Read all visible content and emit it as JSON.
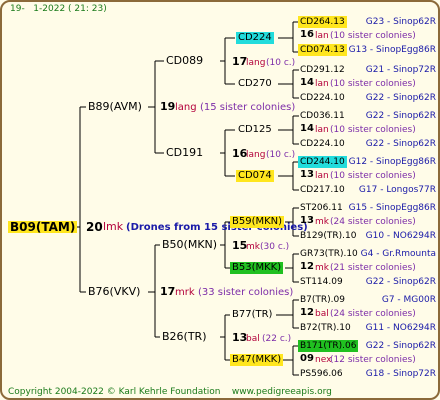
{
  "header": {
    "id_prefix": "19-",
    "datetime": "1-2022 ( 21: 23)"
  },
  "footer": {
    "copyright": "Copyright 2004-2022 © Karl Kehrle Foundation",
    "site": "www.pedigreeapis.org"
  },
  "colors": {
    "yellow": "#ffe61e",
    "cyan": "#22dcdc",
    "lime": "#20c020",
    "tree_line": "#000000",
    "border": "#8b6a3a"
  },
  "root": {
    "name": "B09(TAM)",
    "num": "20",
    "code": "lmk",
    "note": "(Drones from 15 sister colonies)"
  },
  "gen2": [
    {
      "name": "B89(AVM)",
      "num": "19",
      "code": "lang",
      "note": "(15 sister colonies)"
    },
    {
      "name": "B76(VKV)",
      "num": "17",
      "code": "mrk",
      "note": "(33 sister colonies)"
    }
  ],
  "gen3": [
    {
      "name": "CD089",
      "num": "17",
      "code": "lang",
      "note": "(10 c.)"
    },
    {
      "name": "CD191",
      "num": "16",
      "code": "lang",
      "note": "(10 c.)"
    },
    {
      "name": "B50(MKN)",
      "num": "15",
      "code": "mk",
      "note": "(30 c.)"
    },
    {
      "name": "B26(TR)",
      "num": "13",
      "code": "bal",
      "note": "(22 c.)"
    }
  ],
  "gen4": [
    {
      "name": "CD224",
      "hl": "cyan"
    },
    {
      "name": "CD270",
      "hl": ""
    },
    {
      "name": "CD125",
      "hl": ""
    },
    {
      "name": "CD074",
      "hl": "yellow"
    },
    {
      "name": "B59(MKN)",
      "hl": "yellow"
    },
    {
      "name": "B53(MKK)",
      "hl": "lime"
    },
    {
      "name": "B77(TR)",
      "hl": ""
    },
    {
      "name": "B47(MKK)",
      "hl": "yellow"
    }
  ],
  "gen5": [
    {
      "top": "CD264.13",
      "top_hl": "yellow",
      "top_ref": "G23 - Sinop62R",
      "num": "16",
      "code": "lan",
      "note": "(10 sister colonies)",
      "bot": "CD074.13",
      "bot_hl": "yellow",
      "bot_ref": "G13 - SinopEgg86R"
    },
    {
      "top": "CD291.12",
      "top_hl": "",
      "top_ref": "G21 - Sinop72R",
      "num": "14",
      "code": "lan",
      "note": "(10 sister colonies)",
      "bot": "CD224.10",
      "bot_hl": "",
      "bot_ref": "G22 - Sinop62R"
    },
    {
      "top": "CD036.11",
      "top_hl": "",
      "top_ref": "G22 - Sinop62R",
      "num": "14",
      "code": "lan",
      "note": "(10 sister colonies)",
      "bot": "CD224.10",
      "bot_hl": "",
      "bot_ref": "G22 - Sinop62R"
    },
    {
      "top": "CD244.10",
      "top_hl": "cyan",
      "top_ref": "G12 - SinopEgg86R",
      "num": "13",
      "code": "lan",
      "note": "(10 sister colonies)",
      "bot": "CD217.10",
      "bot_hl": "",
      "bot_ref": "G17 - Longos77R"
    },
    {
      "top": "ST206.11",
      "top_hl": "",
      "top_ref": "G15 - SinopEgg86R",
      "num": "13",
      "code": "mk",
      "note": "(24 sister colonies)",
      "bot": "B129(TR).10",
      "bot_hl": "",
      "bot_ref": "G10 - NO6294R"
    },
    {
      "top": "GR73(TR).10",
      "top_hl": "",
      "top_ref": "G4 - Gr.Rmounta",
      "num": "12",
      "code": "mk",
      "note": "(21 sister colonies)",
      "bot": "ST114.09",
      "bot_hl": "",
      "bot_ref": "G22 - Sinop62R"
    },
    {
      "top": "B7(TR).09",
      "top_hl": "",
      "top_ref": "G7 - MG00R",
      "num": "12",
      "code": "bal",
      "note": "(24 sister colonies)",
      "bot": "B72(TR).10",
      "bot_hl": "",
      "bot_ref": "G11 - NO6294R"
    },
    {
      "top": "B171(TR).06",
      "top_hl": "lime",
      "top_ref": "G22 - Sinop62R",
      "num": "09",
      "code": "nex",
      "note": "(12 sister colonies)",
      "bot": "PS596.06",
      "bot_hl": "",
      "bot_ref": "G18 - Sinop72R"
    }
  ]
}
